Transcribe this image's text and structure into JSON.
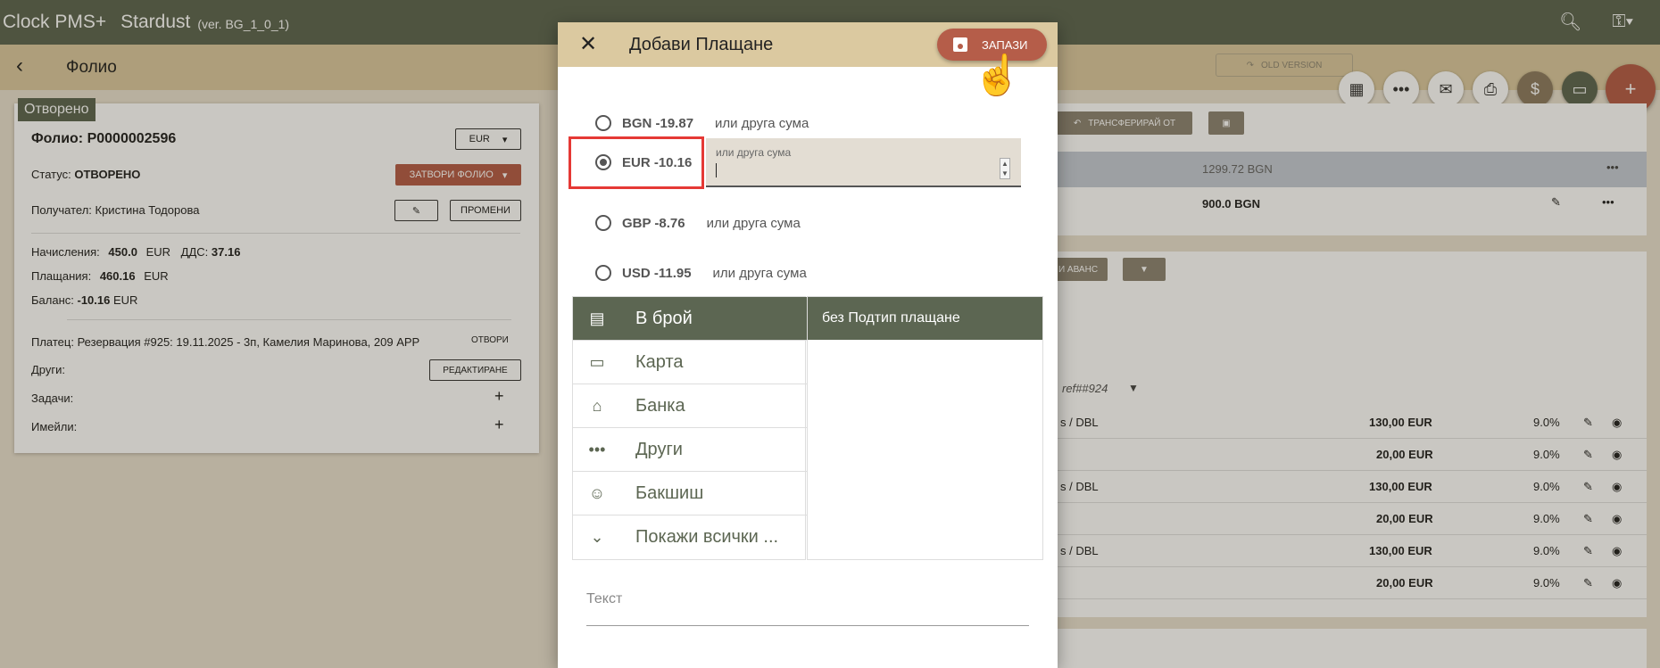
{
  "app": {
    "title": "Clock PMS+",
    "name": "Stardust",
    "version": "(ver. BG_1_0_1)"
  },
  "subheader": {
    "title": "Фолио",
    "old_version": "OLD VERSION"
  },
  "folio": {
    "status_chip": "Отворено",
    "number": "Фолио: P0000002596",
    "currency_select": "EUR",
    "status_label": "Статус:",
    "status_value": "ОТВОРЕНО",
    "close_button": "ЗАТВОРИ ФОЛИО",
    "recipient": "Получател: Кристина Тодорова",
    "change_button": "ПРОМЕНИ",
    "charges_label": "Начисления:",
    "charges_value": "450.0",
    "charges_currency": "EUR",
    "vat_label": "ДДС:",
    "vat_value": "37.16",
    "payments_label": "Плащания:",
    "payments_value": "460.16",
    "payments_currency": "EUR",
    "balance_label": "Баланс:",
    "balance_value": "-10.16",
    "balance_currency": "EUR",
    "payer": "Платец: Резервация #925: 19.11.2025 - 3п, Камелия Маринова, 209 APP",
    "open_link": "ОТВОРИ",
    "others_label": "Други:",
    "edit_button": "РЕДАКТИРАНЕ",
    "tasks_label": "Задачи:",
    "emails_label": "Имейли:"
  },
  "right_panel": {
    "transfer_button": "ТРАНСФЕРИРАЙ ОТ",
    "band_total": "1299.72 BGN",
    "row_amount": "900.0 BGN",
    "advance_button": "И АВАНС",
    "ref": "ref##924",
    "rows": [
      {
        "desc": "s / DBL",
        "amount": "130,00 EUR",
        "vat": "9.0%"
      },
      {
        "desc": "",
        "amount": "20,00 EUR",
        "vat": "9.0%"
      },
      {
        "desc": "s / DBL",
        "amount": "130,00 EUR",
        "vat": "9.0%"
      },
      {
        "desc": "",
        "amount": "20,00 EUR",
        "vat": "9.0%"
      },
      {
        "desc": "s / DBL",
        "amount": "130,00 EUR",
        "vat": "9.0%"
      },
      {
        "desc": "",
        "amount": "20,00 EUR",
        "vat": "9.0%"
      }
    ]
  },
  "dialog": {
    "title": "Добави Плащане",
    "save_button": "ЗАПАЗИ",
    "currencies": [
      {
        "value": "BGN -19.87",
        "other": "или друга сума"
      },
      {
        "value": "EUR -10.16",
        "other": "или друга сума"
      },
      {
        "value": "GBP -8.76",
        "other": "или друга сума"
      },
      {
        "value": "USD -11.95",
        "other": "или друга сума"
      }
    ],
    "amount_label": "или друга сума",
    "payment_methods": [
      {
        "label": "В брой",
        "icon": "cash-icon"
      },
      {
        "label": "Карта",
        "icon": "card-icon"
      },
      {
        "label": "Банка",
        "icon": "bank-icon"
      },
      {
        "label": "Други",
        "icon": "more-icon"
      },
      {
        "label": "Бакшиш",
        "icon": "smile-icon"
      },
      {
        "label": "Покажи всички ...",
        "icon": "chevron-down-icon"
      }
    ],
    "subtype_header": "без Подтип плащане",
    "text_label": "Текст"
  }
}
